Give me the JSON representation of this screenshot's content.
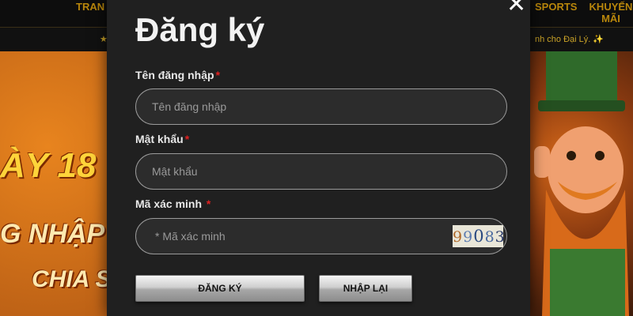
{
  "background": {
    "nav": {
      "left_item": "TRAN",
      "sports": "SPORTS",
      "promo": "KHUYẾN MÃI"
    },
    "ticker": {
      "left": "★",
      "right": "nh cho Đại Lý. ✨"
    },
    "banner": {
      "line1": "ÀY 18",
      "line2": "G NHẬP",
      "line3": "CHIA S"
    }
  },
  "modal": {
    "title": "Đăng ký",
    "username": {
      "label": "Tên đăng nhập",
      "required_mark": "*",
      "placeholder": "Tên đăng nhập",
      "value": ""
    },
    "password": {
      "label": "Mật khẩu",
      "required_mark": "*",
      "placeholder": "Mật khẩu",
      "value": ""
    },
    "captcha": {
      "label": "Mã xác minh",
      "required_mark": "*",
      "placeholder": "* Mã xác minh",
      "value": "",
      "code_chars": [
        "9",
        "9",
        "0",
        "8",
        "3"
      ]
    },
    "register_button": "ĐĂNG KÝ",
    "reset_button": "NHẬP LẠI",
    "close_symbol": "✕"
  },
  "colors": {
    "accent_gold": "#b8860b",
    "required_red": "#e02020",
    "modal_bg": "#202020"
  }
}
